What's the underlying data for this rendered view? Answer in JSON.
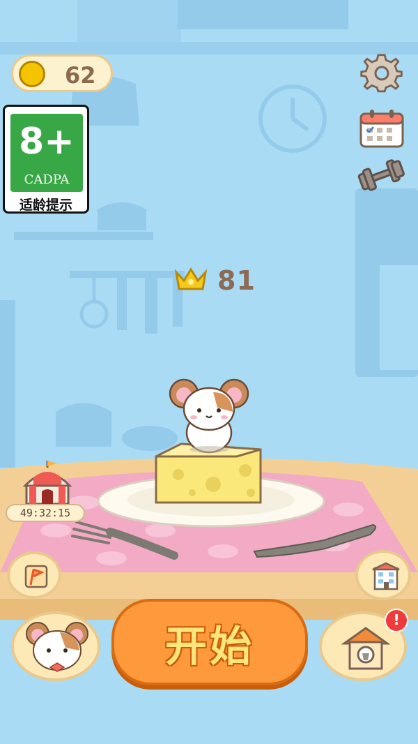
{
  "hud": {
    "coins": "62",
    "best_score": "81",
    "timer": "49:32:15"
  },
  "age_rating": {
    "rating": "8+",
    "org": "CADPA",
    "tip": "适龄提示"
  },
  "start_button": {
    "label": "开始"
  },
  "icons": {
    "coin": "coin-icon",
    "settings": "gear-icon",
    "calendar": "calendar-icon",
    "fitness": "dumbbell-icon",
    "crown": "crown-icon",
    "circus": "circus-tent-icon",
    "flag": "flag-icon",
    "building": "building-icon",
    "hamster_profile": "hamster-icon",
    "house": "hamster-house-icon",
    "alert": "exclamation-badge-icon"
  },
  "colors": {
    "sky": "#a9dbf5",
    "accent_orange": "#ff9a3c",
    "cheese": "#fbe87b",
    "tablecloth": "#f3aac4"
  }
}
